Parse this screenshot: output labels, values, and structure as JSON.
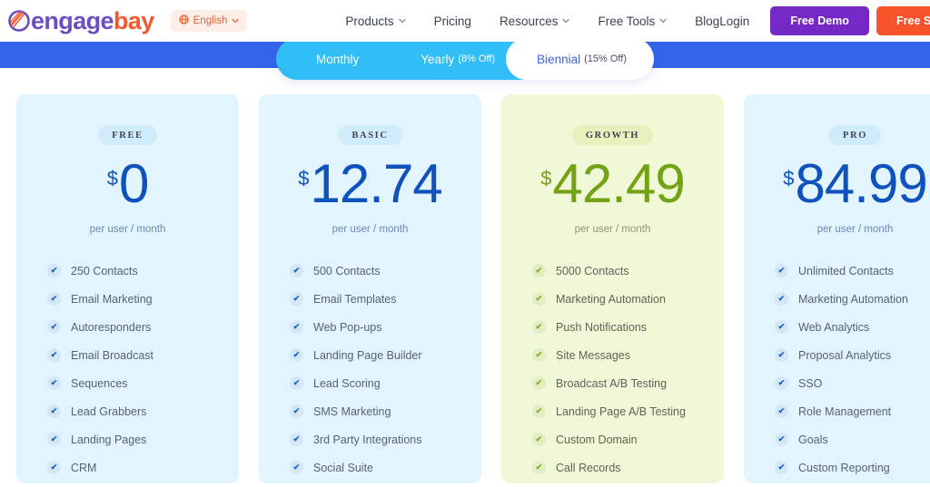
{
  "header": {
    "logo": {
      "part1": "engage",
      "part2": "bay",
      "icon": "engagebay-logo-icon"
    },
    "language": {
      "label": "English",
      "icon": "globe-icon",
      "caret": "⌄"
    },
    "nav": [
      {
        "label": "Products",
        "has_dropdown": true
      },
      {
        "label": "Pricing",
        "has_dropdown": false
      },
      {
        "label": "Resources",
        "has_dropdown": true
      },
      {
        "label": "Free Tools",
        "has_dropdown": true
      },
      {
        "label": "Blog",
        "has_dropdown": false
      }
    ],
    "login_label": "Login",
    "demo_button": {
      "label": "Free Demo",
      "color": "#7429c6"
    },
    "signup_button": {
      "label": "Free Signup",
      "color": "#f9532b"
    }
  },
  "billing_toggle": {
    "band_color": "#3464ea",
    "tabs": [
      {
        "main": "Monthly",
        "sub": "",
        "active": false
      },
      {
        "main": "Yearly",
        "sub": "(8% Off)",
        "active": false
      },
      {
        "main": "Biennial",
        "sub": "(15% Off)",
        "active": true
      }
    ]
  },
  "plans": [
    {
      "badge": "FREE",
      "currency": "$",
      "amount": "0",
      "per_user": "per user / month",
      "theme": "blue",
      "features": [
        "250 Contacts",
        "Email Marketing",
        "Autoresponders",
        "Email Broadcast",
        "Sequences",
        "Lead Grabbers",
        "Landing Pages",
        "CRM"
      ]
    },
    {
      "badge": "BASIC",
      "currency": "$",
      "amount": "12.74",
      "per_user": "per user / month",
      "theme": "blue",
      "features": [
        "500 Contacts",
        "Email Templates",
        "Web Pop-ups",
        "Landing Page Builder",
        "Lead Scoring",
        "SMS Marketing",
        "3rd Party Integrations",
        "Social Suite"
      ]
    },
    {
      "badge": "GROWTH",
      "currency": "$",
      "amount": "42.49",
      "per_user": "per user / month",
      "theme": "green",
      "features": [
        "5000 Contacts",
        "Marketing Automation",
        "Push Notifications",
        "Site Messages",
        "Broadcast A/B Testing",
        "Landing Page A/B Testing",
        "Custom Domain",
        "Call Records"
      ]
    },
    {
      "badge": "PRO",
      "currency": "$",
      "amount": "84.99",
      "per_user": "per user / month",
      "theme": "blue",
      "features": [
        "Unlimited Contacts",
        "Marketing Automation",
        "Web Analytics",
        "Proposal Analytics",
        "SSO",
        "Role Management",
        "Goals",
        "Custom Reporting"
      ]
    }
  ],
  "icons": {
    "check": "✔",
    "caret_down": "⌄",
    "globe": "⊕"
  }
}
